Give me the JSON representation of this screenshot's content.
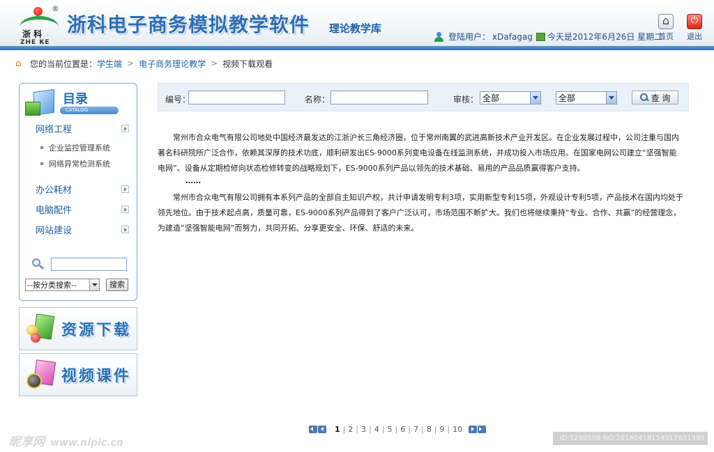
{
  "header": {
    "logo_cn": "浙  科",
    "logo_en": "ZHE  KE",
    "logo_reg": "®",
    "app_title": "浙科电子商务模拟教学软件",
    "subtitle": "理论教学库",
    "user_label": "登陆用户：",
    "username": "xDafagag",
    "date_text": "今天是2012年6月26日  星期二",
    "home_label": "首页",
    "exit_label": "退出",
    "icons": [
      "user-icon",
      "calendar-icon",
      "home-icon",
      "exit-icon"
    ]
  },
  "breadcrumb": {
    "prefix": "您的当前位置是：",
    "items": [
      "学生端",
      "电子商务理论教学",
      "视频下载观看"
    ]
  },
  "sidebar": {
    "catalog_title": "目录",
    "catalog_sub": "CATALOG",
    "items": [
      {
        "label": "网络工程",
        "children": [
          "企业监控管理系统",
          "网络异常检测系统"
        ]
      },
      {
        "label": "办公耗材"
      },
      {
        "label": "电脑配件"
      },
      {
        "label": "网站建设"
      }
    ],
    "search": {
      "input_value": "",
      "select_value": "--按分类搜索--",
      "button_label": "搜索"
    },
    "banners": [
      "资源下载",
      "视频课件"
    ]
  },
  "filter": {
    "number_label": "编号：",
    "number_value": "",
    "name_label": "名称：",
    "name_value": "",
    "review_label": "审核：",
    "select1_value": "全部",
    "select2_value": "全部",
    "query_label": "查 询"
  },
  "content": {
    "paragraph1": "常州市合众电气有限公司地处中国经济最发达的江浙沪长三角经济圈，位于常州南翼的武进高新技术产业开发区。在企业发展过程中，公司注重与国内著名科研院所广泛合作，依赖其深厚的技术功底，顺利研发出ES-9000系列变电设备在线监测系统，并成功投入市场应用。在国家电网公司建立“坚强智能电网”、设备从定期检修向状态检修转变的战略规划下，ES-9000系列产品以领先的技术基础、易用的产品品质赢得客户支持。",
    "ellipsis": "……",
    "paragraph2": "常州市合众电气有限公司拥有本系列产品的全部自主知识产权，共计申请发明专利3项，实用新型专利15项，外观设计专利5项，产品技术在国内均处于领先地位。由于技术起点高，质量可靠，ES-9000系列产品得到了客户广泛认可，市场范围不断扩大。我们也将继续秉持“专业、合作、共赢”的经营理念，为建造“坚强智能电网”而努力，共同开拓、分享更安全、环保、舒适的未来。"
  },
  "pagination": {
    "current": "1",
    "pages": [
      "1",
      "2",
      "3",
      "4",
      "5",
      "6",
      "7",
      "8",
      "9",
      "10"
    ]
  },
  "watermark": {
    "left_text": "昵享网",
    "left_url": "www.nipic.cn",
    "right_text": "ID:5280508 NO:20140418154917631390"
  },
  "colors": {
    "accent": "#1f60a6",
    "header_bar": "#2f6fae",
    "filter_bg": "#e9f1f9"
  }
}
